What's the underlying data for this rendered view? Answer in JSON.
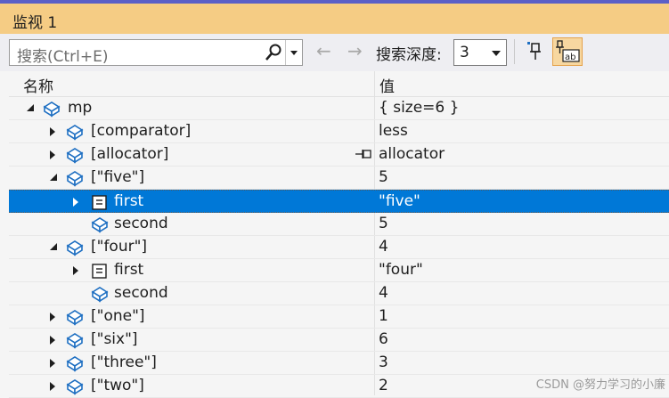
{
  "window": {
    "title": "监视 1"
  },
  "toolbar": {
    "search_placeholder": "搜索(Ctrl+E)",
    "back_arrow": "←",
    "forward_arrow": "→",
    "depth_label": "搜索深度:",
    "depth_value": "3"
  },
  "columns": {
    "name": "名称",
    "value": "值"
  },
  "rows": [
    {
      "name": "mp",
      "value": "{ size=6 }"
    },
    {
      "name": "[comparator]",
      "value": "less"
    },
    {
      "name": "[allocator]",
      "value": "allocator"
    },
    {
      "name": "[\"five\"]",
      "value": "5"
    },
    {
      "name": "first",
      "value": "\"five\""
    },
    {
      "name": "second",
      "value": "5"
    },
    {
      "name": "[\"four\"]",
      "value": "4"
    },
    {
      "name": "first",
      "value": "\"four\""
    },
    {
      "name": "second",
      "value": "4"
    },
    {
      "name": "[\"one\"]",
      "value": "1"
    },
    {
      "name": "[\"six\"]",
      "value": "6"
    },
    {
      "name": "[\"three\"]",
      "value": "3"
    },
    {
      "name": "[\"two\"]",
      "value": "2"
    }
  ],
  "watermark": "CSDN @努力学习的小廉",
  "colors": {
    "title_bg": "#f5cc84",
    "selection": "#0078d7",
    "icon_blue": "#1e6fc2"
  }
}
